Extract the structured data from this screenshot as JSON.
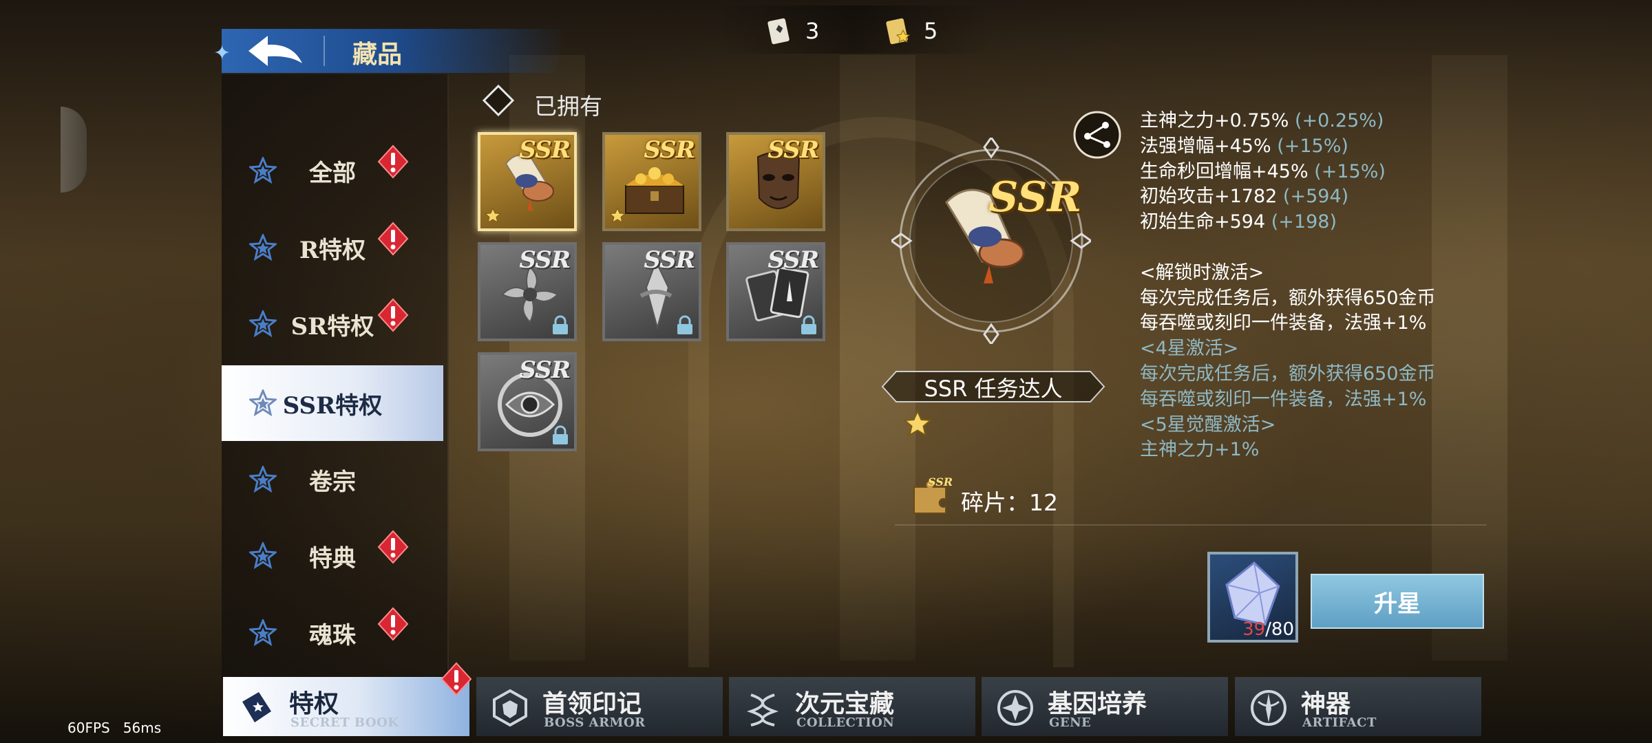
{
  "header": {
    "title": "藏品"
  },
  "resources": [
    {
      "icon": "card-book-icon",
      "value": "3"
    },
    {
      "icon": "star-card-icon",
      "value": "5"
    }
  ],
  "menu": {
    "items": [
      {
        "label": "全部",
        "alert": true,
        "active": false
      },
      {
        "label": "R特权",
        "alert": true,
        "active": false
      },
      {
        "label": "SR特权",
        "alert": true,
        "active": false
      },
      {
        "label": "SSR特权",
        "alert": false,
        "active": true
      },
      {
        "label": "卷宗",
        "alert": false,
        "active": false
      },
      {
        "label": "特典",
        "alert": true,
        "active": false
      },
      {
        "label": "魂珠",
        "alert": true,
        "active": false
      }
    ]
  },
  "filter": {
    "owned_label": "已拥有",
    "checked": false
  },
  "grid": {
    "items": [
      {
        "rarity": "SSR",
        "name": "scroll",
        "owned": true,
        "selected": true,
        "stars": 1
      },
      {
        "rarity": "SSR",
        "name": "treasure-chest",
        "owned": true,
        "selected": false,
        "stars": 1
      },
      {
        "rarity": "SSR",
        "name": "mask",
        "owned": true,
        "selected": false,
        "stars": 0
      },
      {
        "rarity": "SSR",
        "name": "shuriken",
        "owned": false,
        "selected": false,
        "stars": 0
      },
      {
        "rarity": "SSR",
        "name": "blade",
        "owned": false,
        "selected": false,
        "stars": 0
      },
      {
        "rarity": "SSR",
        "name": "cards",
        "owned": false,
        "selected": false,
        "stars": 0
      },
      {
        "rarity": "SSR",
        "name": "eye-emblem",
        "owned": false,
        "selected": false,
        "stars": 0
      }
    ]
  },
  "detail": {
    "rarity": "SSR",
    "name": "SSR 任务达人",
    "stars": 1,
    "fragments_label": "碎片：12",
    "stats": [
      {
        "base": "主神之力+0.75%",
        "bonus": " (+0.25%)"
      },
      {
        "base": "法强增幅+45%",
        "bonus": " (+15%)"
      },
      {
        "base": "生命秒回增幅+45%",
        "bonus": " (+15%)"
      },
      {
        "base": "初始攻击+1782",
        "bonus": " (+594)"
      },
      {
        "base": "初始生命+594",
        "bonus": " (+198)"
      }
    ],
    "effects": [
      {
        "text": "<解锁时激活>",
        "active": true
      },
      {
        "text": "每次完成任务后，额外获得650金币",
        "active": true
      },
      {
        "text": "每吞噬或刻印一件装备，法强+1%",
        "active": true
      },
      {
        "text": "<4星激活>",
        "active": false
      },
      {
        "text": "每次完成任务后，额外获得650金币",
        "active": false
      },
      {
        "text": "每吞噬或刻印一件装备，法强+1%",
        "active": false
      },
      {
        "text": "<5星觉醒激活>",
        "active": false
      },
      {
        "text": "主神之力+1%",
        "active": false
      }
    ],
    "material": {
      "have": "39",
      "need": "/80"
    },
    "upgrade_label": "升星"
  },
  "bottom_tabs": [
    {
      "title": "特权",
      "sub": "SECRET BOOK",
      "icon": "book-icon",
      "active": true,
      "alert": true
    },
    {
      "title": "首领印记",
      "sub": "BOSS ARMOR",
      "icon": "shield-hex-icon",
      "active": false,
      "alert": false
    },
    {
      "title": "次元宝藏",
      "sub": "COLLECTION",
      "icon": "helix-icon",
      "active": false,
      "alert": false
    },
    {
      "title": "基因培养",
      "sub": "GENE",
      "icon": "gene-star-icon",
      "active": false,
      "alert": false
    },
    {
      "title": "神器",
      "sub": "ARTIFACT",
      "icon": "artifact-icon",
      "active": false,
      "alert": false
    }
  ],
  "debug": {
    "fps": "60FPS",
    "ping": "56ms"
  },
  "colors": {
    "accent_blue": "#2e66b3",
    "gold": "#ffe07a",
    "alert_red": "#d92633",
    "stat_bonus": "#8fb8c4"
  }
}
